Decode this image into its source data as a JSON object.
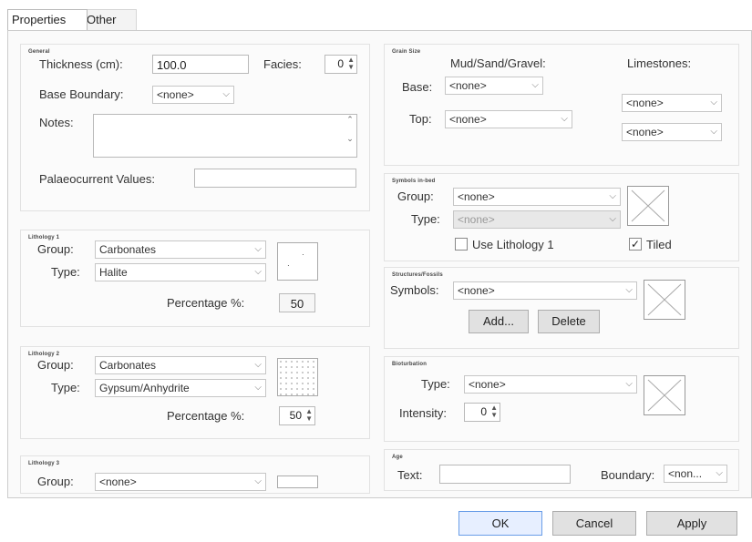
{
  "tabs": [
    {
      "label": "Properties"
    },
    {
      "label": "Other"
    }
  ],
  "general": {
    "title": "General",
    "thickness_label": "Thickness (cm):",
    "thickness_value": "100.0",
    "facies_label": "Facies:",
    "facies_value": "0",
    "base_boundary_label": "Base Boundary:",
    "base_boundary_value": "<none>",
    "notes_label": "Notes:",
    "notes_value": "",
    "palaeocurrent_label": "Palaeocurrent Values:",
    "palaeocurrent_value": ""
  },
  "lithology1": {
    "title": "Lithology 1",
    "group_label": "Group:",
    "group_value": "Carbonates",
    "type_label": "Type:",
    "type_value": "Halite",
    "percentage_label": "Percentage %:",
    "percentage_value": "50"
  },
  "lithology2": {
    "title": "Lithology 2",
    "group_label": "Group:",
    "group_value": "Carbonates",
    "type_label": "Type:",
    "type_value": "Gypsum/Anhydrite",
    "percentage_label": "Percentage %:",
    "percentage_value": "50"
  },
  "lithology3": {
    "title": "Lithology 3",
    "group_label": "Group:",
    "group_value": "<none>"
  },
  "grain_size": {
    "title": "Grain Size",
    "mud_label": "Mud/Sand/Gravel:",
    "limestones_label": "Limestones:",
    "base_label": "Base:",
    "base_value": "<none>",
    "top_label": "Top:",
    "top_value": "<none>",
    "lime_base_value": "<none>",
    "lime_top_value": "<none>"
  },
  "symbols_infill": {
    "title": "Symbols in-bed",
    "group_label": "Group:",
    "group_value": "<none>",
    "type_label": "Type:",
    "type_value": "<none>",
    "use_lithology_label": "Use Lithology 1",
    "use_lithology_checked": false,
    "tiled_label": "Tiled",
    "tiled_checked": true
  },
  "structures": {
    "title": "Structures/Fossils",
    "symbols_label": "Symbols:",
    "symbols_value": "<none>",
    "add_label": "Add...",
    "delete_label": "Delete"
  },
  "bioturbation": {
    "title": "Bioturbation",
    "type_label": "Type:",
    "type_value": "<none>",
    "intensity_label": "Intensity:",
    "intensity_value": "0"
  },
  "age": {
    "title": "Age",
    "text_label": "Text:",
    "text_value": "",
    "boundary_label": "Boundary:",
    "boundary_value": "<non..."
  },
  "buttons": {
    "ok": "OK",
    "cancel": "Cancel",
    "apply": "Apply"
  },
  "icons": {
    "dropdown": "chevron-down-icon",
    "spin": "spin-updown-icon",
    "check": "checkmark-icon"
  }
}
